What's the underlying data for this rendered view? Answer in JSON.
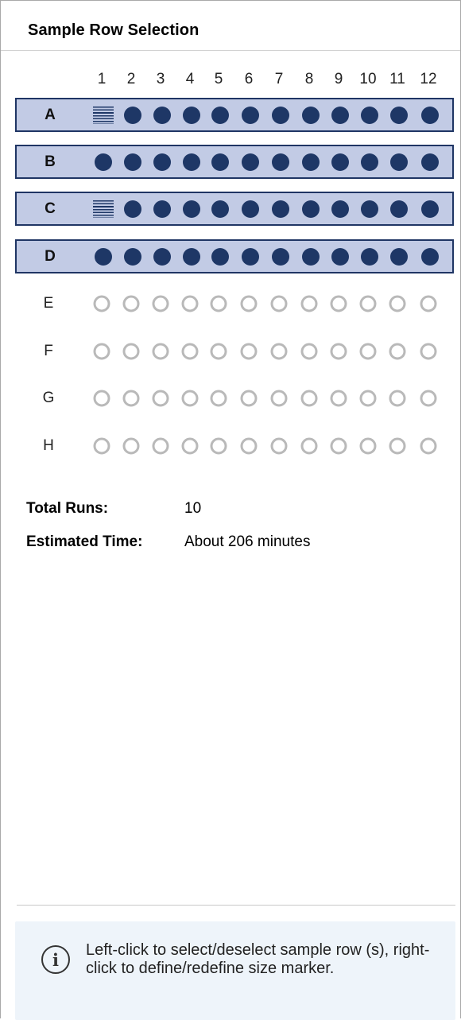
{
  "panel": {
    "title": "Sample Row Selection"
  },
  "plate": {
    "columns": [
      "1",
      "2",
      "3",
      "4",
      "5",
      "6",
      "7",
      "8",
      "9",
      "10",
      "11",
      "12"
    ],
    "rows": [
      {
        "label": "A",
        "selected": true,
        "wells": [
          "marker",
          "filled",
          "filled",
          "filled",
          "filled",
          "filled",
          "filled",
          "filled",
          "filled",
          "filled",
          "filled",
          "filled"
        ]
      },
      {
        "label": "B",
        "selected": true,
        "wells": [
          "filled",
          "filled",
          "filled",
          "filled",
          "filled",
          "filled",
          "filled",
          "filled",
          "filled",
          "filled",
          "filled",
          "filled"
        ]
      },
      {
        "label": "C",
        "selected": true,
        "wells": [
          "marker",
          "filled",
          "filled",
          "filled",
          "filled",
          "filled",
          "filled",
          "filled",
          "filled",
          "filled",
          "filled",
          "filled"
        ]
      },
      {
        "label": "D",
        "selected": true,
        "wells": [
          "filled",
          "filled",
          "filled",
          "filled",
          "filled",
          "filled",
          "filled",
          "filled",
          "filled",
          "filled",
          "filled",
          "filled"
        ]
      },
      {
        "label": "E",
        "selected": false,
        "wells": [
          "empty",
          "empty",
          "empty",
          "empty",
          "empty",
          "empty",
          "empty",
          "empty",
          "empty",
          "empty",
          "empty",
          "empty"
        ]
      },
      {
        "label": "F",
        "selected": false,
        "wells": [
          "empty",
          "empty",
          "empty",
          "empty",
          "empty",
          "empty",
          "empty",
          "empty",
          "empty",
          "empty",
          "empty",
          "empty"
        ]
      },
      {
        "label": "G",
        "selected": false,
        "wells": [
          "empty",
          "empty",
          "empty",
          "empty",
          "empty",
          "empty",
          "empty",
          "empty",
          "empty",
          "empty",
          "empty",
          "empty"
        ]
      },
      {
        "label": "H",
        "selected": false,
        "wells": [
          "empty",
          "empty",
          "empty",
          "empty",
          "empty",
          "empty",
          "empty",
          "empty",
          "empty",
          "empty",
          "empty",
          "empty"
        ]
      }
    ]
  },
  "summary": {
    "total_runs_label": "Total Runs:",
    "total_runs_value": "10",
    "estimated_time_label": "Estimated Time:",
    "estimated_time_value": "About 206 minutes"
  },
  "info": {
    "icon": "info-icon",
    "text": "Left-click to select/deselect sample row (s), right-click to define/redefine size marker."
  },
  "colors": {
    "selected_fill": "#c2cbe5",
    "selected_border": "#1f3564",
    "well_filled": "#1e3766",
    "well_empty_ring": "#b9b9b9",
    "info_background": "#eef4fa"
  }
}
